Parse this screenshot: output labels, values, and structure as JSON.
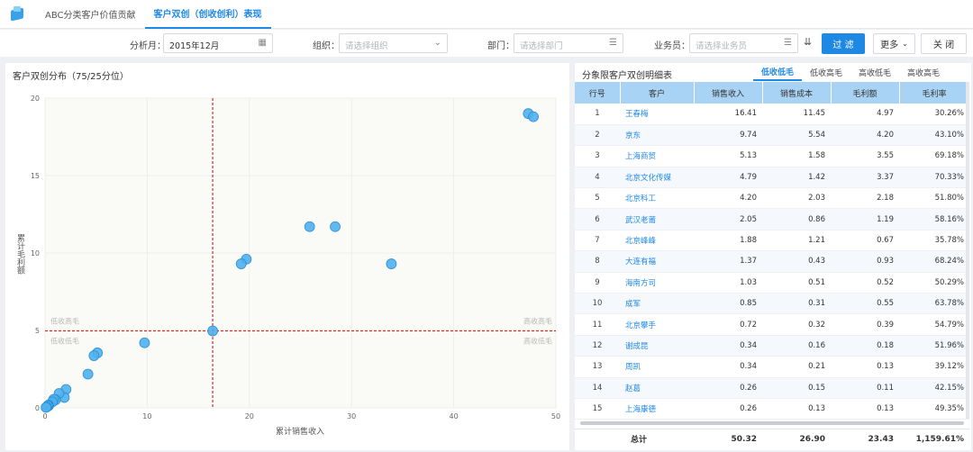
{
  "nav": {
    "tabs": [
      {
        "label": "ABC分类客户价值贡献",
        "active": false
      },
      {
        "label": "客户双创（创收创利）表现",
        "active": true
      }
    ]
  },
  "filters": {
    "month_label": "分析月：",
    "month_value": "2015年12月",
    "org_label": "组织：",
    "org_placeholder": "请选择组织",
    "dept_label": "部门：",
    "dept_placeholder": "请选择部门",
    "sales_label": "业务员：",
    "sales_placeholder": "请选择业务员",
    "filter_button": "过 滤",
    "more_button": "更多",
    "close_button": "关 闭"
  },
  "chart_panel": {
    "title": "客户双创分布（75/25分位）"
  },
  "chart_data": {
    "type": "scatter",
    "xlabel": "累计销售收入",
    "ylabel": "累计毛利额",
    "xlim": [
      0,
      50
    ],
    "ylim": [
      0,
      20
    ],
    "xticks": [
      0,
      10,
      20,
      30,
      40,
      50
    ],
    "yticks": [
      0,
      5,
      10,
      15,
      20
    ],
    "x_threshold": 16.41,
    "y_threshold": 4.97,
    "quadrant_labels": {
      "top_left": "低收高毛",
      "top_right": "高收高毛",
      "bottom_left": "低收低毛",
      "bottom_right": "高收低毛"
    },
    "colors": {
      "point": "#4fb0ec",
      "point_stroke": "#2a8fd6",
      "threshold": "#d32f2f"
    },
    "points": [
      {
        "x": 47.3,
        "y": 19.0
      },
      {
        "x": 47.8,
        "y": 18.8
      },
      {
        "x": 25.9,
        "y": 11.7
      },
      {
        "x": 28.4,
        "y": 11.7
      },
      {
        "x": 19.7,
        "y": 9.6
      },
      {
        "x": 19.2,
        "y": 9.3
      },
      {
        "x": 33.9,
        "y": 9.3
      },
      {
        "x": 16.41,
        "y": 4.97
      },
      {
        "x": 9.74,
        "y": 4.2
      },
      {
        "x": 5.13,
        "y": 3.55
      },
      {
        "x": 4.79,
        "y": 3.37
      },
      {
        "x": 4.2,
        "y": 2.18
      },
      {
        "x": 2.05,
        "y": 1.19
      },
      {
        "x": 1.88,
        "y": 0.67
      },
      {
        "x": 1.37,
        "y": 0.93
      },
      {
        "x": 1.03,
        "y": 0.52
      },
      {
        "x": 0.85,
        "y": 0.55
      },
      {
        "x": 0.72,
        "y": 0.39
      },
      {
        "x": 0.34,
        "y": 0.18
      },
      {
        "x": 0.34,
        "y": 0.13
      },
      {
        "x": 0.26,
        "y": 0.11
      },
      {
        "x": 0.26,
        "y": 0.13
      },
      {
        "x": 0.15,
        "y": 0.05
      },
      {
        "x": 0.1,
        "y": 0.03
      }
    ]
  },
  "table_panel": {
    "title": "分象限客户双创明细表",
    "tabs": [
      {
        "label": "低收低毛",
        "active": true
      },
      {
        "label": "低收高毛",
        "active": false
      },
      {
        "label": "高收低毛",
        "active": false
      },
      {
        "label": "高收高毛",
        "active": false
      }
    ],
    "columns": [
      "行号",
      "客户",
      "销售收入",
      "销售成本",
      "毛利额",
      "毛利率"
    ],
    "rows": [
      [
        "1",
        "王春梅",
        "16.41",
        "11.45",
        "4.97",
        "30.26%"
      ],
      [
        "2",
        "京东",
        "9.74",
        "5.54",
        "4.20",
        "43.10%"
      ],
      [
        "3",
        "上海商贸",
        "5.13",
        "1.58",
        "3.55",
        "69.18%"
      ],
      [
        "4",
        "北京文化传媒",
        "4.79",
        "1.42",
        "3.37",
        "70.33%"
      ],
      [
        "5",
        "北京科工",
        "4.20",
        "2.03",
        "2.18",
        "51.80%"
      ],
      [
        "6",
        "武汉老莆",
        "2.05",
        "0.86",
        "1.19",
        "58.16%"
      ],
      [
        "7",
        "北京峰峰",
        "1.88",
        "1.21",
        "0.67",
        "35.78%"
      ],
      [
        "8",
        "大连有福",
        "1.37",
        "0.43",
        "0.93",
        "68.24%"
      ],
      [
        "9",
        "海南方司",
        "1.03",
        "0.51",
        "0.52",
        "50.29%"
      ],
      [
        "10",
        "成军",
        "0.85",
        "0.31",
        "0.55",
        "63.78%"
      ],
      [
        "11",
        "北京攀手",
        "0.72",
        "0.32",
        "0.39",
        "54.79%"
      ],
      [
        "12",
        "谢成昆",
        "0.34",
        "0.16",
        "0.18",
        "51.96%"
      ],
      [
        "13",
        "周凯",
        "0.34",
        "0.21",
        "0.13",
        "39.12%"
      ],
      [
        "14",
        "赵葛",
        "0.26",
        "0.15",
        "0.11",
        "42.15%"
      ],
      [
        "15",
        "上海康德",
        "0.26",
        "0.13",
        "0.13",
        "49.35%"
      ]
    ],
    "total": {
      "label": "总计",
      "revenue": "50.32",
      "cost": "26.90",
      "profit": "23.43",
      "margin": "1,159.61%"
    }
  }
}
